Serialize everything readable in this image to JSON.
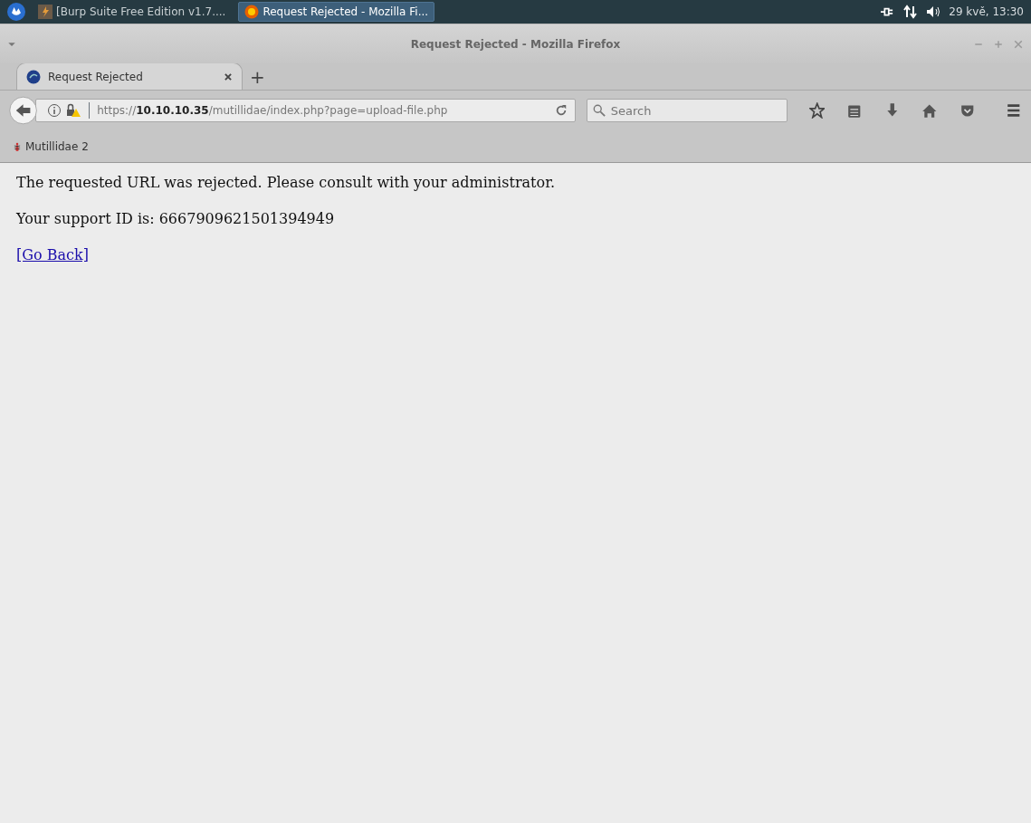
{
  "taskbar": {
    "tasks": [
      {
        "label": "[Burp Suite Free Edition v1.7....",
        "selected": false
      },
      {
        "label": "Request Rejected - Mozilla Fi...",
        "selected": true
      }
    ],
    "clock": "29 kvě, 13:30"
  },
  "window": {
    "title": "Request Rejected - Mozilla Firefox"
  },
  "tabs": [
    {
      "label": "Request Rejected",
      "selected": true
    }
  ],
  "new_tab": "+",
  "address": {
    "scheme": "https://",
    "host": "10.10.10.35",
    "path": "/mutillidae/index.php?page=upload-file.php"
  },
  "search": {
    "placeholder": "Search"
  },
  "bookmarks": [
    {
      "label": "Mutillidae 2"
    }
  ],
  "page": {
    "paragraphs": [
      "The requested URL was rejected. Please consult with your administrator.",
      "Your support ID is: 6667909621501394949"
    ],
    "link": "[Go Back]"
  }
}
